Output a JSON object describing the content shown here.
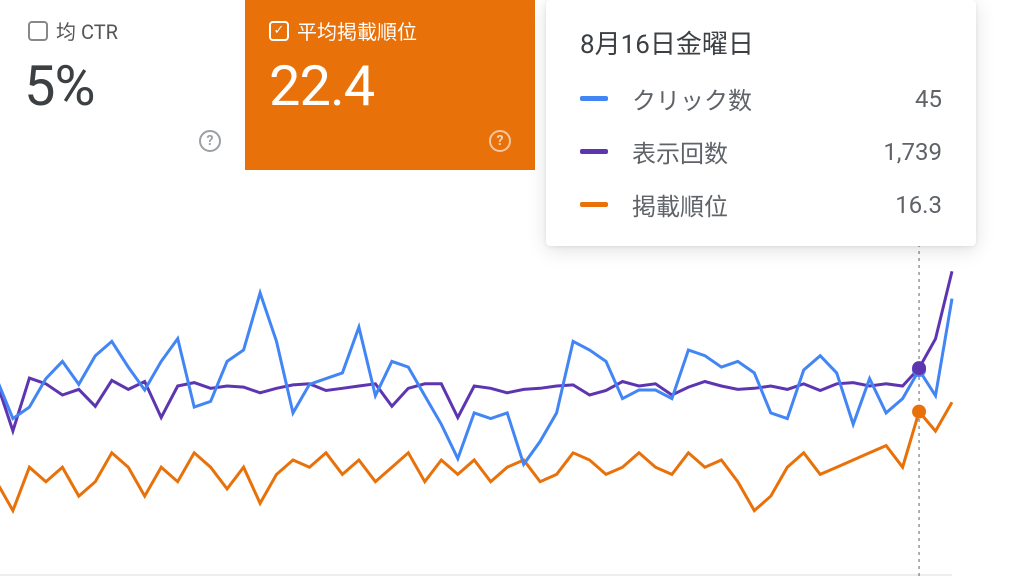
{
  "cards": {
    "ctr": {
      "label": "均 CTR",
      "value": "5%"
    },
    "position": {
      "label": "平均掲載順位",
      "value": "22.4"
    }
  },
  "tooltip": {
    "date": "8月16日金曜日",
    "rows": [
      {
        "label": "クリック数",
        "value": "45"
      },
      {
        "label": "表示回数",
        "value": "1,739"
      },
      {
        "label": "掲載順位",
        "value": "16.3"
      }
    ]
  },
  "chart_data": {
    "type": "line",
    "xlabel": "",
    "ylabel": "",
    "hover_index": 57,
    "series": [
      {
        "name": "クリック数",
        "color": "#4285f4",
        "values": [
          42,
          42,
          28,
          32,
          42,
          48,
          40,
          50,
          55,
          46,
          38,
          48,
          56,
          32,
          34,
          48,
          52,
          72,
          55,
          30,
          40,
          42,
          44,
          60,
          36,
          48,
          46,
          36,
          26,
          14,
          30,
          28,
          30,
          12,
          20,
          30,
          55,
          52,
          48,
          35,
          38,
          38,
          35,
          52,
          50,
          46,
          48,
          44,
          30,
          28,
          45,
          50,
          44,
          26,
          42,
          30,
          35,
          45,
          36,
          70
        ]
      },
      {
        "name": "表示回数",
        "color": "#5e35b1",
        "values": [
          1500,
          1620,
          1180,
          1650,
          1600,
          1500,
          1550,
          1400,
          1630,
          1550,
          1620,
          1300,
          1580,
          1610,
          1560,
          1580,
          1570,
          1520,
          1560,
          1590,
          1600,
          1540,
          1560,
          1580,
          1600,
          1400,
          1560,
          1600,
          1600,
          1300,
          1580,
          1560,
          1520,
          1550,
          1560,
          1580,
          1590,
          1500,
          1540,
          1620,
          1580,
          1600,
          1500,
          1570,
          1620,
          1580,
          1550,
          1560,
          1580,
          1550,
          1600,
          1540,
          1600,
          1610,
          1580,
          1600,
          1580,
          1739,
          2000,
          2600
        ]
      },
      {
        "name": "掲載順位",
        "color": "#e8710a",
        "values": [
          23,
          26,
          30,
          24,
          26,
          24,
          28,
          26,
          22,
          24,
          28,
          24,
          26,
          22,
          24,
          27,
          24,
          29,
          25,
          23,
          24,
          22,
          25,
          23,
          26,
          24,
          22,
          26,
          23,
          25,
          23,
          26,
          24,
          23,
          26,
          25,
          22,
          23,
          25,
          24,
          22,
          24,
          25,
          22,
          24,
          23,
          26,
          30,
          28,
          24,
          22,
          25,
          24,
          23,
          22,
          21,
          24,
          16.3,
          19,
          15
        ]
      }
    ]
  }
}
